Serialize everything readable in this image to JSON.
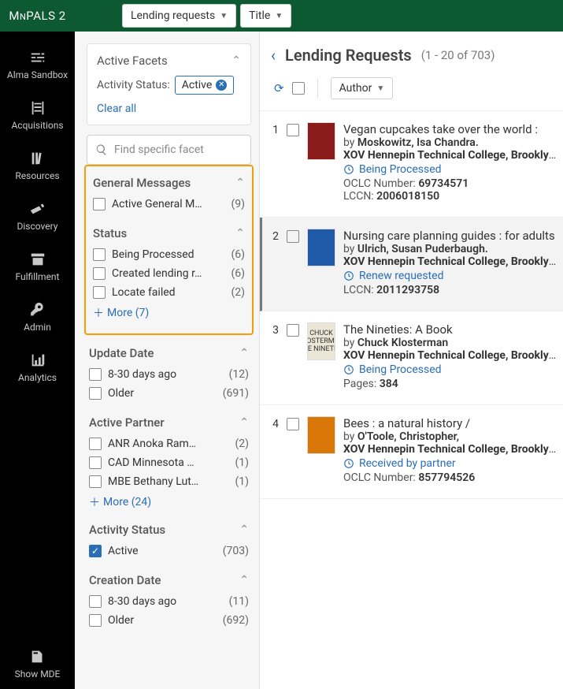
{
  "brand": {
    "pre": "M",
    "small": "N",
    "rest": "PALS 2"
  },
  "top": {
    "dd1": "Lending requests",
    "dd2": "Title"
  },
  "sidenav": {
    "items": [
      "Alma Sandbox",
      "Acquisitions",
      "Resources",
      "Discovery",
      "Fulfillment",
      "Admin",
      "Analytics"
    ],
    "bottom": "Show MDE"
  },
  "facets": {
    "activeTitle": "Active Facets",
    "activityStatusLabel": "Activity Status:",
    "activeChip": "Active",
    "clearAll": "Clear all",
    "searchPlaceholder": "Find specific facet",
    "groups": {
      "generalMessages": {
        "title": "General Messages",
        "items": [
          {
            "label": "Active General M…",
            "count": "(9)"
          }
        ]
      },
      "status": {
        "title": "Status",
        "items": [
          {
            "label": "Being Processed",
            "count": "(6)"
          },
          {
            "label": "Created lending r…",
            "count": "(6)"
          },
          {
            "label": "Locate failed",
            "count": "(2)"
          }
        ],
        "more": "More (7)"
      },
      "updateDate": {
        "title": "Update Date",
        "items": [
          {
            "label": "8-30 days ago",
            "count": "(12)"
          },
          {
            "label": "Older",
            "count": "(691)"
          }
        ]
      },
      "activePartner": {
        "title": "Active Partner",
        "items": [
          {
            "label": "ANR Anoka Ram…",
            "count": "(2)"
          },
          {
            "label": "CAD Minnesota …",
            "count": "(1)"
          },
          {
            "label": "MBE Bethany Lut…",
            "count": "(1)"
          }
        ],
        "more": "More (24)"
      },
      "activityStatus": {
        "title": "Activity Status",
        "items": [
          {
            "label": "Active",
            "count": "(703)",
            "checked": true
          }
        ]
      },
      "creationDate": {
        "title": "Creation Date",
        "items": [
          {
            "label": "8-30 days ago",
            "count": "(11)"
          },
          {
            "label": "Older",
            "count": "(692)"
          }
        ]
      }
    },
    "moreGlyph": "＋"
  },
  "main": {
    "title": "Lending Requests",
    "count": "(1 - 20 of 703)",
    "sort": "Author"
  },
  "rows": [
    {
      "n": "1",
      "thumbBg": "#8b1a1a",
      "title": "Vegan cupcakes take over the world :",
      "byPre": "by ",
      "author": "Moskowitz, Isa Chandra.",
      "loc": "XOV Hennepin Technical College, Brooklyn Park",
      "status": "Being Processed",
      "m1Label": "OCLC Number:",
      "m1Val": "69734571",
      "m2Label": "LCCN:",
      "m2Val": "2006018150"
    },
    {
      "n": "2",
      "selected": true,
      "thumbBg": "#1e5aa8",
      "title": "Nursing care planning guides : for adults",
      "byPre": "by ",
      "author": "Ulrich, Susan Puderbaugh.",
      "loc": "XOV Hennepin Technical College, Brooklyn Park",
      "status": "Renew requested",
      "m1Label": "LCCN:",
      "m1Val": "2011293758"
    },
    {
      "n": "3",
      "thumbBg": "#ece6d6",
      "thumbText": "CHUCK KLOSTERMAN THE NINETIES",
      "title": "The Nineties: A Book",
      "byPre": "by ",
      "author": "Chuck Klosterman",
      "loc": "XOV Hennepin Technical College, Brooklyn Park",
      "status": "Being Processed",
      "m1Label": "Pages:",
      "m1Val": "384"
    },
    {
      "n": "4",
      "thumbBg": "#d97706",
      "title": "Bees : a natural history /",
      "byPre": "by ",
      "author": "O'Toole, Christopher,",
      "loc": "XOV Hennepin Technical College, Brooklyn Park",
      "status": "Received by partner",
      "m1Label": "OCLC Number:",
      "m1Val": "857794526"
    }
  ]
}
